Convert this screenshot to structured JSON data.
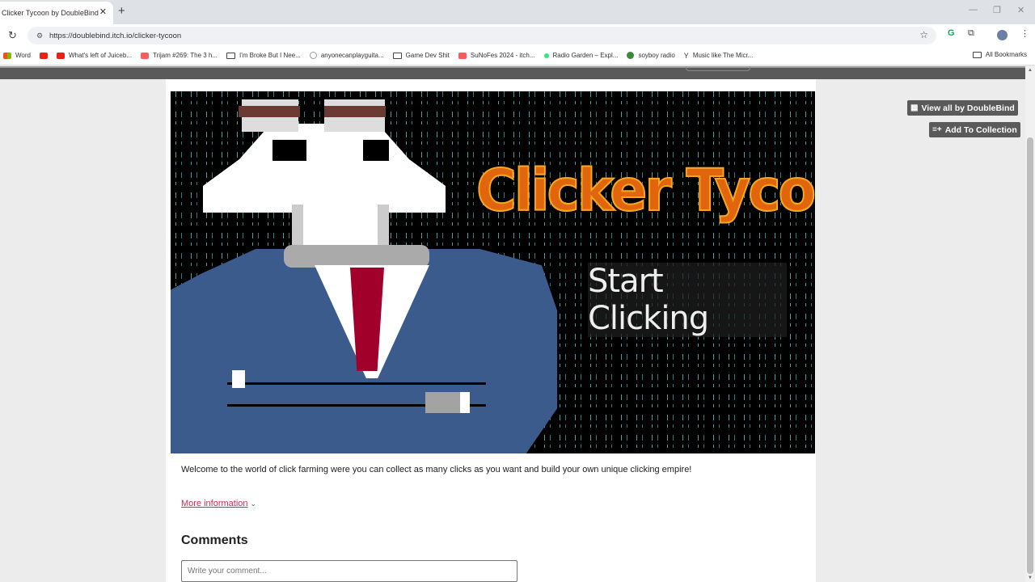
{
  "browser": {
    "tab_title": "Clicker Tycoon by DoubleBind",
    "url": "https://doublebind.itch.io/clicker-tycoon",
    "bookmarks": [
      {
        "label": "Word",
        "icon": "word-icon",
        "color": "#2b7cd3"
      },
      {
        "label": "",
        "icon": "youtube-icon",
        "color": "#e62117"
      },
      {
        "label": "What's left of Juiceb...",
        "icon": "youtube-icon",
        "color": "#e62117"
      },
      {
        "label": "Trijam #269: The 3 h...",
        "icon": "itch-icon",
        "color": "#fa5c5c"
      },
      {
        "label": "I'm Broke But I Nee...",
        "icon": "folder-icon",
        "color": "#444444"
      },
      {
        "label": "anyonecanplayguita...",
        "icon": "globe-icon",
        "color": "#999999"
      },
      {
        "label": "Game Dev Shit",
        "icon": "folder-icon",
        "color": "#444444"
      },
      {
        "label": "SuNoFes 2024 - itch...",
        "icon": "itch-icon",
        "color": "#fa5c5c"
      },
      {
        "label": "Radio Garden – Expl...",
        "icon": "radio-garden-icon",
        "color": "#2ee87a"
      },
      {
        "label": "soyboy radio",
        "icon": "globe-icon",
        "color": "#3a8a3a"
      },
      {
        "label": "Music like The Micr...",
        "icon": "cocktail-icon",
        "color": "#444444"
      }
    ],
    "all_bookmarks": "All Bookmarks"
  },
  "page": {
    "cover": {
      "game_title": "Clicker Tycoon",
      "start_button": "Start Clicking"
    },
    "description": "Welcome to the world of click farming were you can collect as many clicks as you want and build your own unique clicking empire!",
    "more_info": "More information",
    "comments_heading": "Comments",
    "comment_placeholder": "Write your comment...",
    "side": {
      "view_all": "View all by DoubleBind",
      "add_collection": "Add To Collection"
    }
  },
  "colors": {
    "accent_link": "#da2c4f",
    "title_orange": "#e0650d",
    "suit_blue": "#3a5b8c",
    "tie_red": "#a0002a"
  }
}
